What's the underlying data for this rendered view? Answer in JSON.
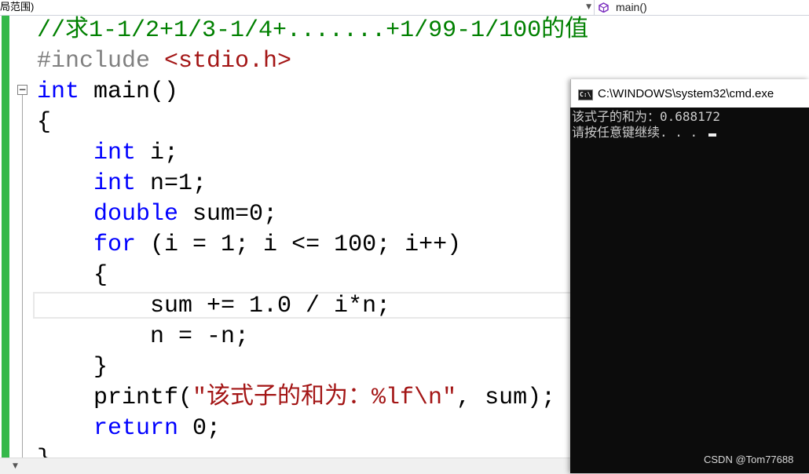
{
  "navbar": {
    "scope_label": "局范围)",
    "member_label": "main()"
  },
  "code": [
    [
      {
        "t": "//求1-1/2+1/3-1/4+.......+1/99-1/100的值",
        "c": "cm"
      }
    ],
    [
      {
        "t": "#include ",
        "c": "pp"
      },
      {
        "t": "<stdio.h>",
        "c": "inc"
      }
    ],
    [
      {
        "t": "int",
        "c": "kw"
      },
      {
        "t": " main()",
        "c": ""
      }
    ],
    [
      {
        "t": "{",
        "c": ""
      }
    ],
    [
      {
        "t": "    ",
        "c": ""
      },
      {
        "t": "int",
        "c": "kw"
      },
      {
        "t": " i;",
        "c": ""
      }
    ],
    [
      {
        "t": "    ",
        "c": ""
      },
      {
        "t": "int",
        "c": "kw"
      },
      {
        "t": " n=1;",
        "c": ""
      }
    ],
    [
      {
        "t": "    ",
        "c": ""
      },
      {
        "t": "double",
        "c": "kw"
      },
      {
        "t": " sum=0;",
        "c": ""
      }
    ],
    [
      {
        "t": "    ",
        "c": ""
      },
      {
        "t": "for",
        "c": "kw"
      },
      {
        "t": " (i = 1; i <= 100; i++)",
        "c": ""
      }
    ],
    [
      {
        "t": "    {",
        "c": ""
      }
    ],
    [
      {
        "t": "        sum += 1.0 / i*n;",
        "c": ""
      }
    ],
    [
      {
        "t": "        n = -n;",
        "c": ""
      }
    ],
    [
      {
        "t": "    }",
        "c": ""
      }
    ],
    [
      {
        "t": "    printf(",
        "c": ""
      },
      {
        "t": "\"该式子的和为：%lf\\n\"",
        "c": "str"
      },
      {
        "t": ", sum);",
        "c": ""
      }
    ],
    [
      {
        "t": "    ",
        "c": ""
      },
      {
        "t": "return",
        "c": "kw"
      },
      {
        "t": " 0;",
        "c": ""
      }
    ],
    [
      {
        "t": "}",
        "c": ""
      }
    ]
  ],
  "console": {
    "title": "C:\\WINDOWS\\system32\\cmd.exe",
    "icon_label": "C:\\",
    "lines": [
      "该式子的和为：0.688172",
      "请按任意键继续. . . "
    ]
  },
  "watermark": "CSDN @Tom77688",
  "colors": {
    "keyword": "#0000ff",
    "comment": "#008000",
    "string": "#a31515",
    "change_bar": "#35b84a",
    "console_bg": "#0c0c0c"
  },
  "icons": {
    "member": "method-cube-icon",
    "dropdown": "chevron-down-icon",
    "collapse": "collapse-minus-icon",
    "console": "console-app-icon"
  }
}
